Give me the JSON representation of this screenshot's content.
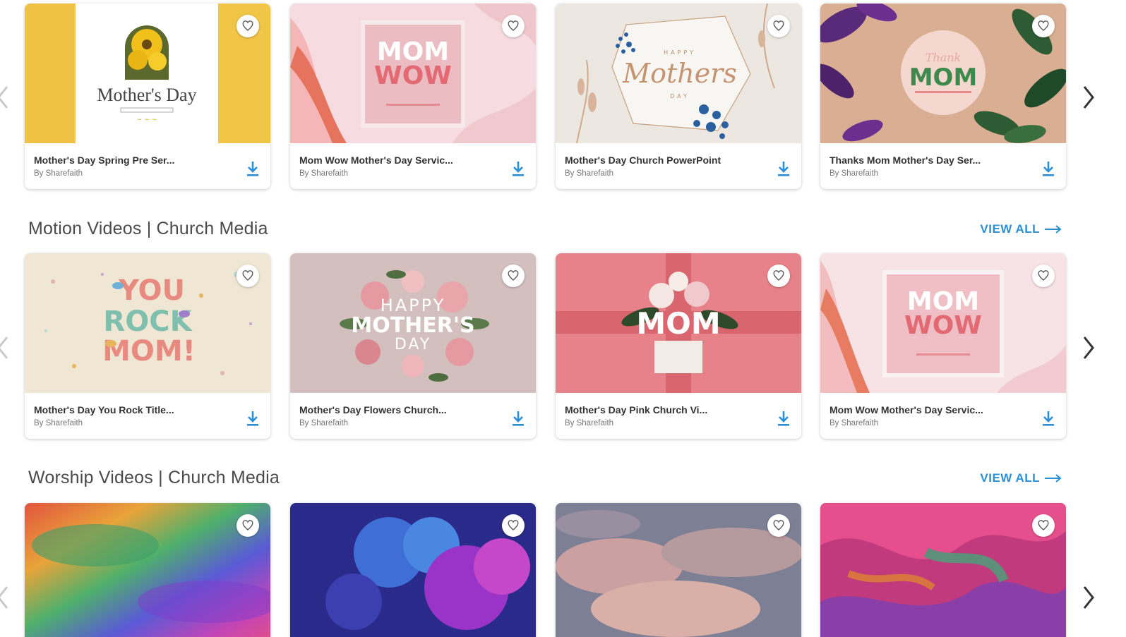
{
  "sections": [
    {
      "id": "top",
      "title": "",
      "view_all": "",
      "cards": [
        {
          "title": "Mother's Day Spring Pre Ser...",
          "author": "By Sharefaith",
          "art": "sunflower"
        },
        {
          "title": "Mom Wow Mother's Day Servic...",
          "author": "By Sharefaith",
          "art": "momwow"
        },
        {
          "title": "Mother's Day Church PowerPoint",
          "author": "By Sharefaith",
          "art": "mothersday"
        },
        {
          "title": "Thanks Mom Mother's Day Ser...",
          "author": "By Sharefaith",
          "art": "thanksmom"
        }
      ]
    },
    {
      "id": "motion",
      "title": "Motion Videos | Church Media",
      "view_all": "VIEW ALL",
      "cards": [
        {
          "title": "Mother's Day You Rock Title...",
          "author": "By Sharefaith",
          "art": "yourock"
        },
        {
          "title": "Mother's Day Flowers Church...",
          "author": "By Sharefaith",
          "art": "flowers"
        },
        {
          "title": "Mother's Day Pink Church Vi...",
          "author": "By Sharefaith",
          "art": "pinkmom"
        },
        {
          "title": "Mom Wow Mother's Day Servic...",
          "author": "By Sharefaith",
          "art": "momwow2"
        }
      ]
    },
    {
      "id": "worship",
      "title": "Worship Videos | Church Media",
      "view_all": "VIEW ALL",
      "cards": [
        {
          "title": "",
          "author": "",
          "art": "rainbow"
        },
        {
          "title": "",
          "author": "",
          "art": "smoke"
        },
        {
          "title": "",
          "author": "",
          "art": "clouds"
        },
        {
          "title": "",
          "author": "",
          "art": "marble"
        }
      ]
    }
  ],
  "thumb_text": {
    "sunflower": {
      "main": "Mother's Day"
    },
    "momwow": {
      "l1": "MOM",
      "l2": "WOW"
    },
    "mothersday": {
      "top": "HAPPY",
      "main": "Mothers",
      "bottom": "DAY"
    },
    "thanksmom": {
      "main": "MOM"
    },
    "yourock": {
      "l1": "YOU",
      "l2": "ROCK",
      "l3": "MOM!"
    },
    "flowers": {
      "l1": "HAPPY",
      "l2": "MOTHER'S",
      "l3": "DAY"
    },
    "pinkmom": {
      "main": "MOM"
    },
    "momwow2": {
      "l1": "MOM",
      "l2": "WOW"
    }
  },
  "colors": {
    "accent": "#2b8fd6",
    "title_text": "#333333",
    "section_text": "#4a4a4a"
  },
  "icons": {
    "favorite": "heart-outline-icon",
    "download": "download-arrow-icon",
    "prev": "chevron-left-icon",
    "next": "chevron-right-icon",
    "view_all": "long-arrow-right-icon"
  }
}
